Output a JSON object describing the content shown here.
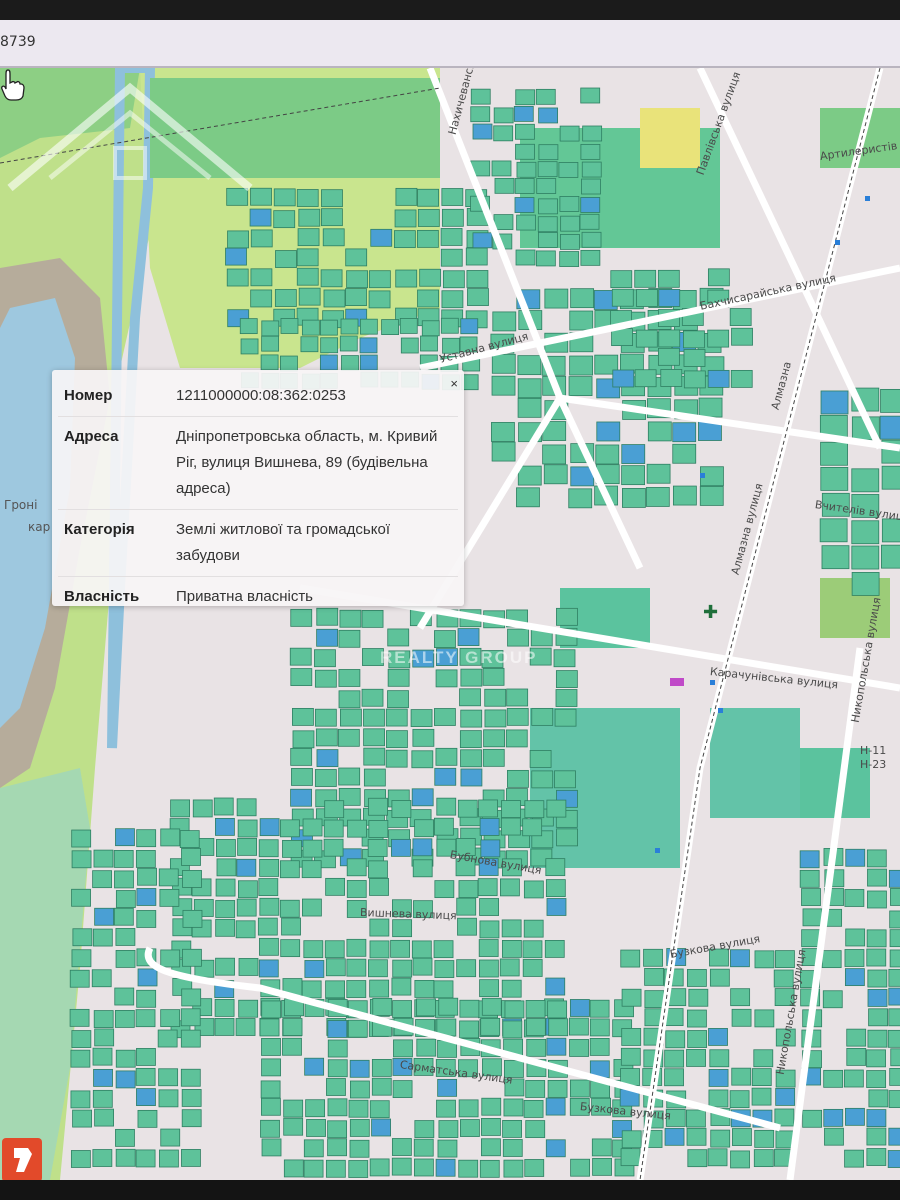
{
  "browser": {
    "url_fragment": "8739"
  },
  "popup": {
    "close_label": "×",
    "rows": [
      {
        "key": "Номер",
        "value": "1211000000:08:362:0253"
      },
      {
        "key": "Адреса",
        "value": "Дніпропетровська область, м. Кривий Ріг, вулиця Вишнева, 89 (будівельна адреса)"
      },
      {
        "key": "Категорія",
        "value": "Землі житлової та громадської забудови"
      },
      {
        "key": "Власність",
        "value": "Приватна власність"
      }
    ]
  },
  "watermark": {
    "text": "REALTY GROUP"
  },
  "streets": [
    "Нахичеванська вулиця",
    "Павлівська вулиця",
    "Артилеристів",
    "Бахчисарайська вулиця",
    "Уставна вулиця",
    "Алмазна",
    "Алмазна вулиця",
    "Вчителів вулиця",
    "Карачунівська вулиця",
    "Вишнева вулиця",
    "Бубнова вулиця",
    "Бузкова вулиця",
    "Сарматська вулиця",
    "Бузкова вулиця",
    "Никопольська вулиця",
    "Никопольська вулиця",
    "Гроні",
    "кар",
    "H-11",
    "H-23"
  ],
  "colors": {
    "parcel_green": "#5ec29a",
    "parcel_blue": "#4a9fd4",
    "forest": "#7cc77a",
    "meadow": "#b7db7a",
    "water": "#9cc8e0",
    "urban": "#e7e1e3"
  },
  "icons": {
    "cursor": "hand-pointer-icon",
    "close": "close-icon",
    "app": "app-launcher-icon"
  }
}
